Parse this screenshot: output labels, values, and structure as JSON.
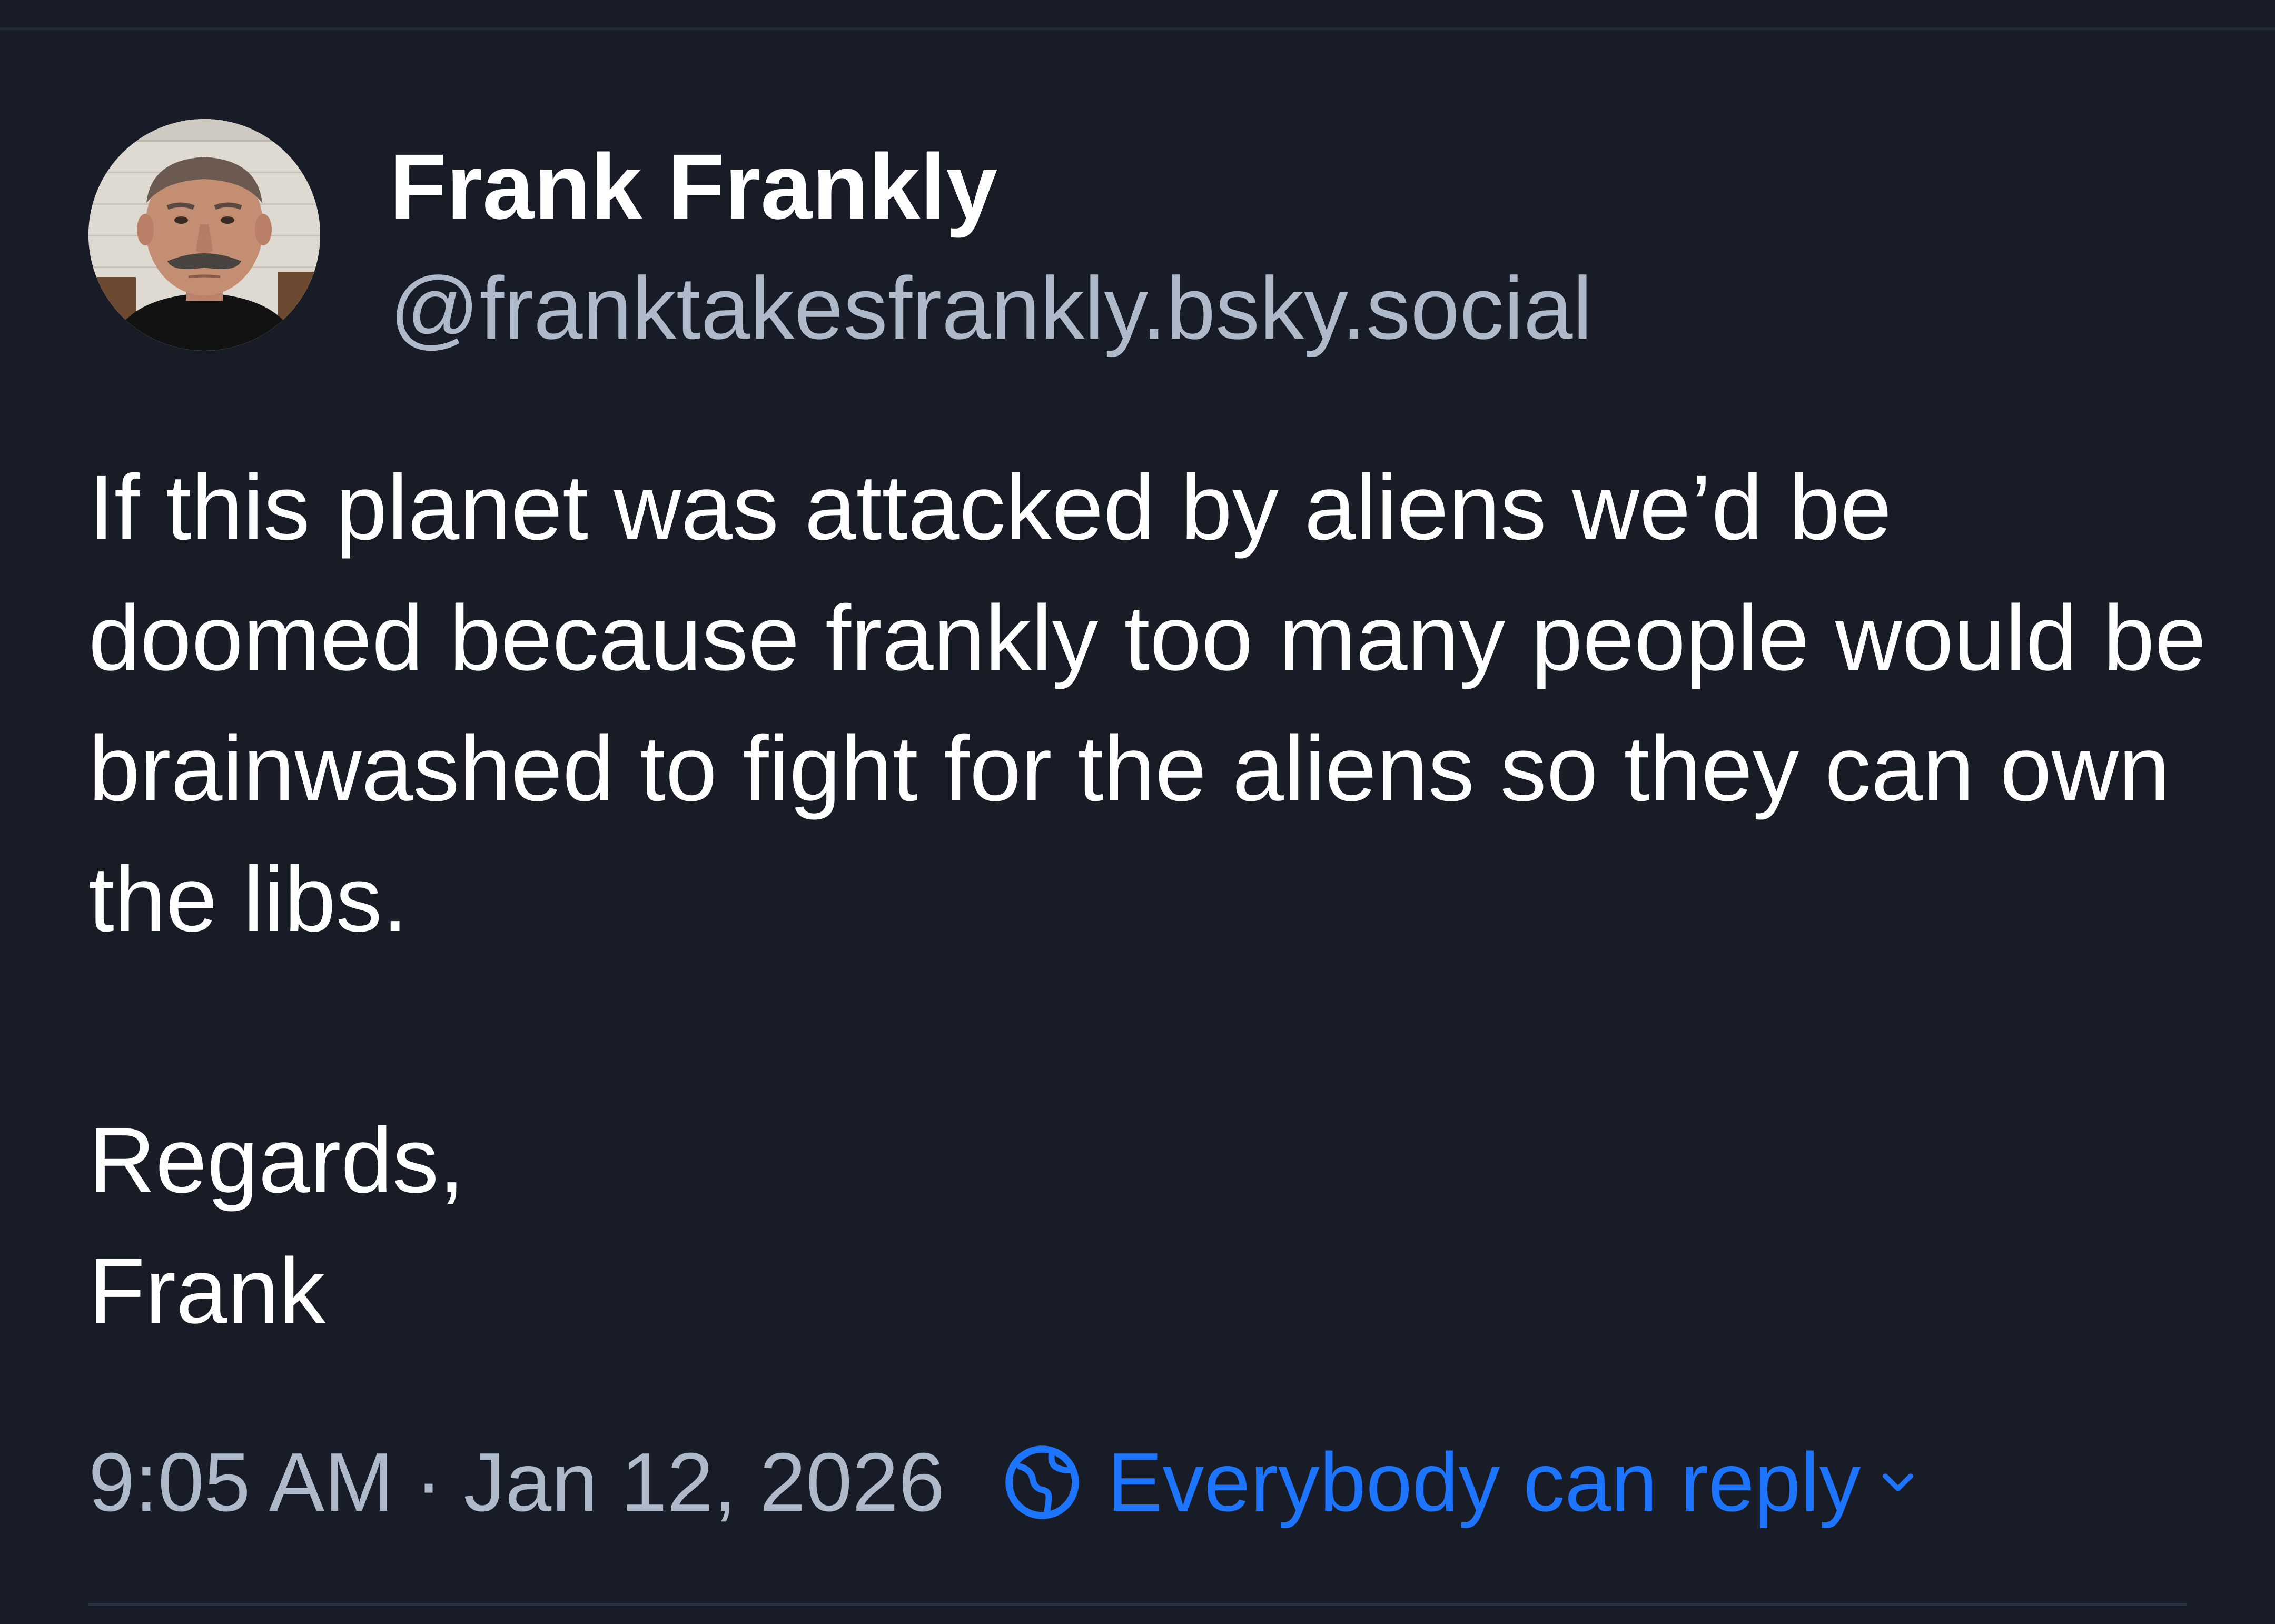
{
  "post": {
    "author": {
      "display_name": "Frank Frankly",
      "handle": "@franktakesfrankly.bsky.social",
      "avatar": "profile-photo"
    },
    "text": "If this planet was attacked by aliens we’d be doomed because frankly too many people would be brainwashed to fight for the aliens so they can own the libs.\n\nRegards,\nFrank",
    "time": "9:05 AM",
    "separator": "·",
    "date": "Jan 12, 2026",
    "reply_setting": {
      "icon": "globe-icon",
      "label": "Everybody can reply",
      "dropdown_icon": "chevron-down-icon"
    }
  },
  "colors": {
    "background": "#181c27",
    "primary_text": "#ffffff",
    "secondary_text": "#aeb9ca",
    "accent": "#1c74ff"
  }
}
